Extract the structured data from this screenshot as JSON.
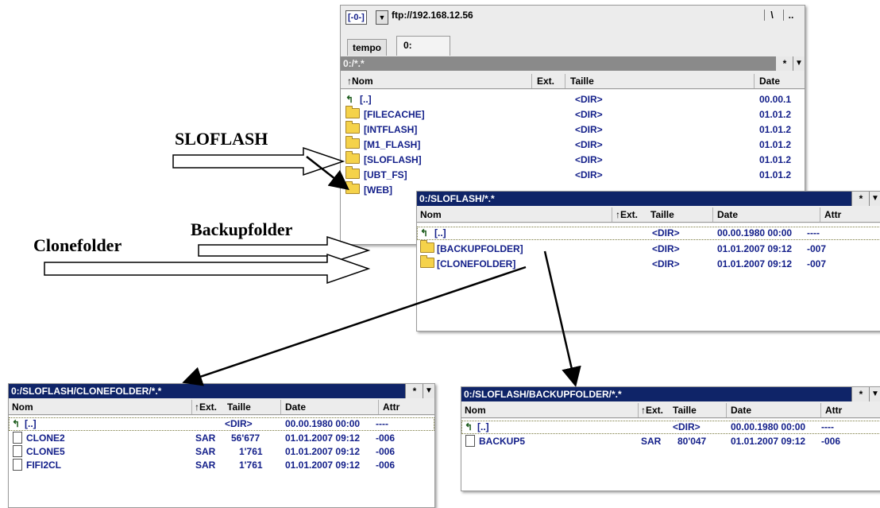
{
  "main_panel": {
    "drive": "[-0-]",
    "address": "ftp://192.168.12.56",
    "btn_root": "\\",
    "btn_up": "..",
    "tabs": [
      "tempo",
      "0:"
    ],
    "path": "0:/*.*",
    "filter_btn": "*",
    "columns": {
      "name": "↑Nom",
      "ext": "Ext.",
      "size": "Taille",
      "date": "Date"
    },
    "rows": [
      {
        "name": "[..]",
        "size": "<DIR>",
        "date": "00.00.1"
      },
      {
        "name": "[FILECACHE]",
        "size": "<DIR>",
        "date": "01.01.2"
      },
      {
        "name": "[INTFLASH]",
        "size": "<DIR>",
        "date": "01.01.2"
      },
      {
        "name": "[M1_FLASH]",
        "size": "<DIR>",
        "date": "01.01.2"
      },
      {
        "name": "[SLOFLASH]",
        "size": "<DIR>",
        "date": "01.01.2"
      },
      {
        "name": "[UBT_FS]",
        "size": "<DIR>",
        "date": "01.01.2"
      },
      {
        "name": "[WEB]",
        "size": "",
        "date": ""
      }
    ]
  },
  "sloflash_panel": {
    "path": "0:/SLOFLASH/*.*",
    "filter_btn": "*",
    "columns": {
      "name": "Nom",
      "ext": "↑Ext.",
      "size": "Taille",
      "date": "Date",
      "attr": "Attr"
    },
    "rows": [
      {
        "name": "[..]",
        "size": "<DIR>",
        "date": "00.00.1980 00:00",
        "attr": "----"
      },
      {
        "name": "[BACKUPFOLDER]",
        "size": "<DIR>",
        "date": "01.01.2007 09:12",
        "attr": "-007"
      },
      {
        "name": "[CLONEFOLDER]",
        "size": "<DIR>",
        "date": "01.01.2007 09:12",
        "attr": "-007"
      }
    ]
  },
  "clone_panel": {
    "path": "0:/SLOFLASH/CLONEFOLDER/*.*",
    "filter_btn": "*",
    "columns": {
      "name": "Nom",
      "ext": "↑Ext.",
      "size": "Taille",
      "date": "Date",
      "attr": "Attr"
    },
    "rows": [
      {
        "name": "[..]",
        "ext": "",
        "size": "<DIR>",
        "date": "00.00.1980 00:00",
        "attr": "----"
      },
      {
        "name": "CLONE2",
        "ext": "SAR",
        "size": "56'677",
        "date": "01.01.2007 09:12",
        "attr": "-006"
      },
      {
        "name": "CLONE5",
        "ext": "SAR",
        "size": "1'761",
        "date": "01.01.2007 09:12",
        "attr": "-006"
      },
      {
        "name": "FIFI2CL",
        "ext": "SAR",
        "size": "1'761",
        "date": "01.01.2007 09:12",
        "attr": "-006"
      }
    ]
  },
  "backup_panel": {
    "path": "0:/SLOFLASH/BACKUPFOLDER/*.*",
    "filter_btn": "*",
    "columns": {
      "name": "Nom",
      "ext": "↑Ext.",
      "size": "Taille",
      "date": "Date",
      "attr": "Attr"
    },
    "rows": [
      {
        "name": "[..]",
        "ext": "",
        "size": "<DIR>",
        "date": "00.00.1980 00:00",
        "attr": "----"
      },
      {
        "name": "BACKUP5",
        "ext": "SAR",
        "size": "80'047",
        "date": "01.01.2007 09:12",
        "attr": "-006"
      }
    ]
  },
  "annotations": {
    "sloflash": "SLOFLASH",
    "backupfolder": "Backupfolder",
    "clonefolder": "Clonefolder"
  },
  "icons": [
    "folder-icon",
    "file-icon",
    "up-dir-icon",
    "dropdown-arrow-icon"
  ]
}
